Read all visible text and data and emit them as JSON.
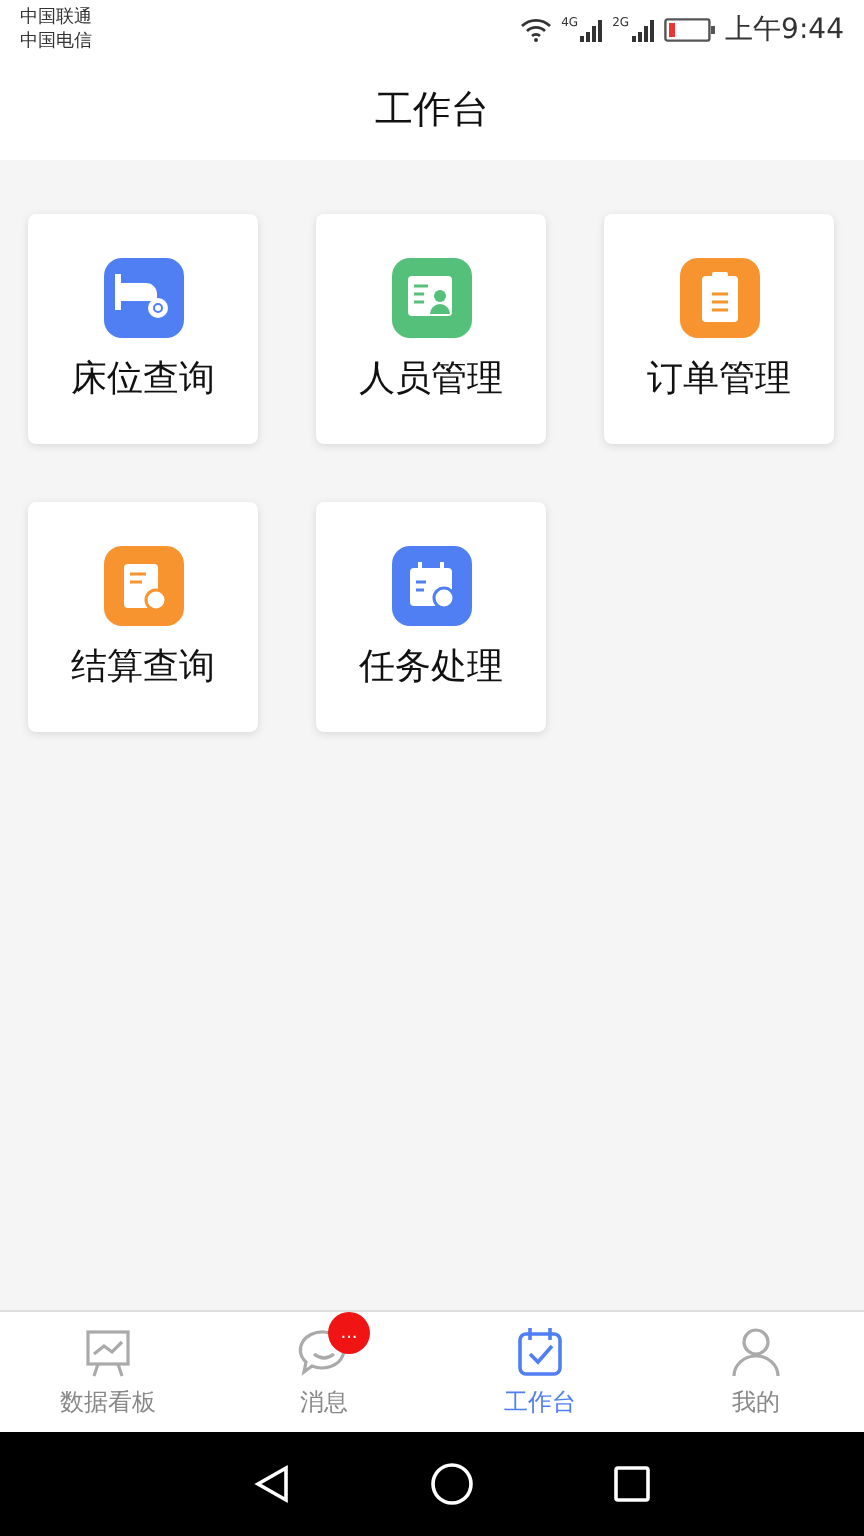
{
  "status_bar": {
    "carriers": [
      "中国联通",
      "中国电信"
    ],
    "networks": [
      "4G",
      "2G"
    ],
    "time": "上午9:44"
  },
  "header": {
    "title": "工作台"
  },
  "tiles": [
    {
      "label": "床位查询",
      "kind": "bed",
      "color": "#4f7ff3"
    },
    {
      "label": "人员管理",
      "kind": "person-card",
      "color": "#55c07a"
    },
    {
      "label": "订单管理",
      "kind": "clipboard",
      "color": "#f7942f"
    },
    {
      "label": "结算查询",
      "kind": "receipt",
      "color": "#f7942f"
    },
    {
      "label": "任务处理",
      "kind": "calendar",
      "color": "#4f7ff3"
    }
  ],
  "tab_bar": [
    {
      "label": "数据看板",
      "kind": "board",
      "selected": false
    },
    {
      "label": "消息",
      "kind": "chat",
      "selected": false,
      "badge": "..."
    },
    {
      "label": "工作台",
      "kind": "calendar-check",
      "selected": true
    },
    {
      "label": "我的",
      "kind": "person",
      "selected": false
    }
  ],
  "nav_bar": [
    {
      "kind": "back"
    },
    {
      "kind": "home"
    },
    {
      "kind": "recents"
    }
  ]
}
